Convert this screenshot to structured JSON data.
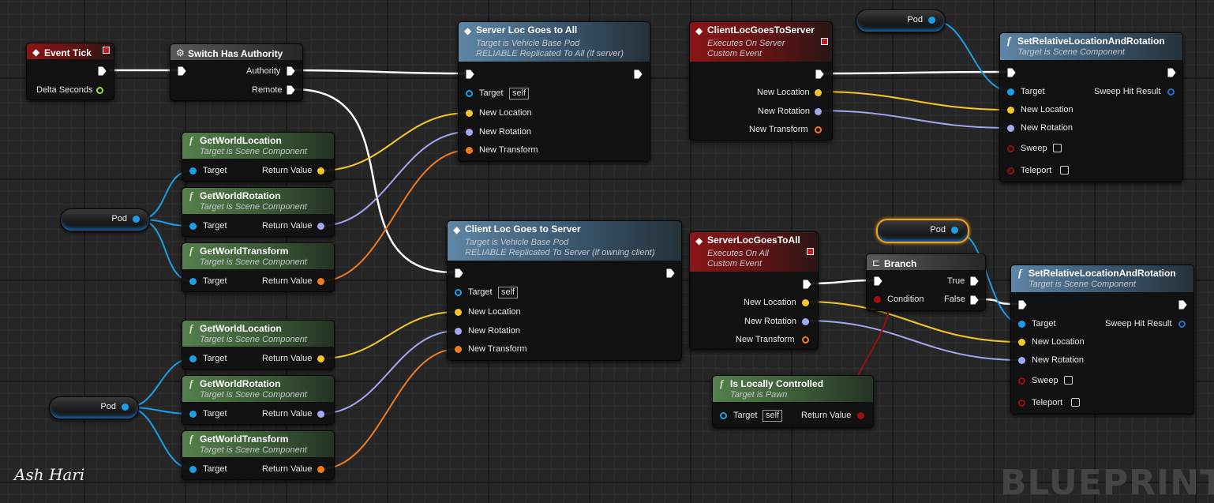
{
  "colors": {
    "exec": "#ffffff",
    "vector": "#f4c62c",
    "rotator": "#a3a8f0",
    "transform": "#f07c22",
    "object": "#1c9ee4",
    "bool": "#9a1010",
    "float": "#9bde4a",
    "struct": "#1f6fd0"
  },
  "event_tick": {
    "title": "Event Tick",
    "delta_seconds": "Delta Seconds",
    "icon": "event-diamond-icon"
  },
  "switch_authority": {
    "title": "Switch Has Authority",
    "authority": "Authority",
    "remote": "Remote",
    "icon": "switch-gear-icon"
  },
  "server_loc_all": {
    "title": "Server Loc Goes to All",
    "sub1": "Target is Vehicle Base Pod",
    "sub2": "RELIABLE Replicated To All (if server)",
    "target": "Target",
    "self": "self",
    "new_location": "New Location",
    "new_rotation": "New Rotation",
    "new_transform": "New Transform"
  },
  "client_loc_server": {
    "title": "Client Loc Goes to Server",
    "sub1": "Target is Vehicle Base Pod",
    "sub2": "RELIABLE Replicated To Server (if owning client)",
    "target": "Target",
    "self": "self",
    "new_location": "New Location",
    "new_rotation": "New Rotation",
    "new_transform": "New Transform"
  },
  "client_event": {
    "title": "ClientLocGoesToServer",
    "sub1": "Executes On Server",
    "sub2": "Custom Event",
    "new_location": "New Location",
    "new_rotation": "New Rotation",
    "new_transform": "New Transform"
  },
  "server_event": {
    "title": "ServerLocGoesToAll",
    "sub1": "Executes On All",
    "sub2": "Custom Event",
    "new_location": "New Location",
    "new_rotation": "New Rotation",
    "new_transform": "New Transform"
  },
  "get_nodes": [
    {
      "title": "GetWorldLocation",
      "sub": "Target is Scene Component",
      "target": "Target",
      "ret": "Return Value"
    },
    {
      "title": "GetWorldRotation",
      "sub": "Target is Scene Component",
      "target": "Target",
      "ret": "Return Value"
    },
    {
      "title": "GetWorldTransform",
      "sub": "Target is Scene Component",
      "target": "Target",
      "ret": "Return Value"
    },
    {
      "title": "GetWorldLocation",
      "sub": "Target is Scene Component",
      "target": "Target",
      "ret": "Return Value"
    },
    {
      "title": "GetWorldRotation",
      "sub": "Target is Scene Component",
      "target": "Target",
      "ret": "Return Value"
    },
    {
      "title": "GetWorldTransform",
      "sub": "Target is Scene Component",
      "target": "Target",
      "ret": "Return Value"
    }
  ],
  "set_nodes": [
    {
      "title": "SetRelativeLocationAndRotation",
      "sub": "Target is Scene Component",
      "target": "Target",
      "sweep_hit": "Sweep Hit Result",
      "new_location": "New Location",
      "new_rotation": "New Rotation",
      "sweep": "Sweep",
      "teleport": "Teleport"
    },
    {
      "title": "SetRelativeLocationAndRotation",
      "sub": "Target is Scene Component",
      "target": "Target",
      "sweep_hit": "Sweep Hit Result",
      "new_location": "New Location",
      "new_rotation": "New Rotation",
      "sweep": "Sweep",
      "teleport": "Teleport"
    }
  ],
  "branch": {
    "title": "Branch",
    "condition": "Condition",
    "true_label": "True",
    "false_label": "False",
    "icon": "branch-icon"
  },
  "locally_controlled": {
    "title": "Is Locally Controlled",
    "sub": "Target is Pawn",
    "target": "Target",
    "self": "self",
    "ret": "Return Value"
  },
  "pod_vars": [
    {
      "label": "Pod"
    },
    {
      "label": "Pod"
    },
    {
      "label": "Pod"
    },
    {
      "label": "Pod"
    }
  ],
  "signature": "Ash Hari",
  "watermark": "BLUEPRINT"
}
